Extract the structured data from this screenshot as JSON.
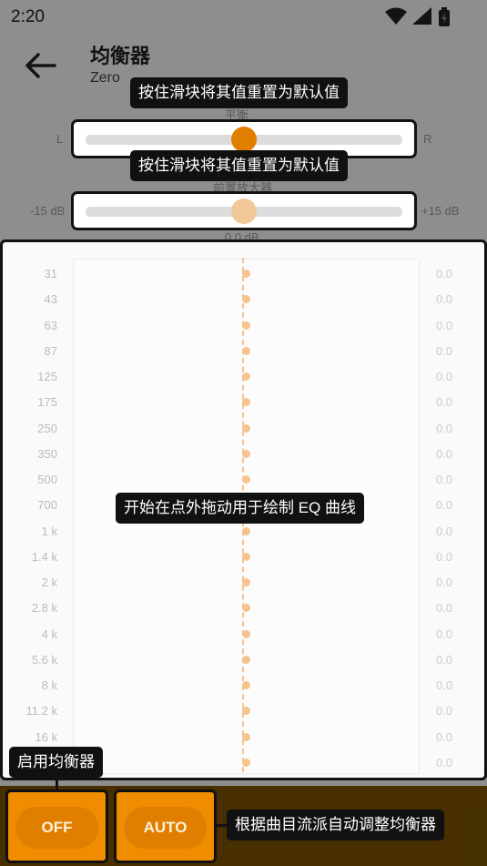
{
  "status_bar": {
    "time": "2:20"
  },
  "header": {
    "title": "均衡器",
    "subtitle": "Zero"
  },
  "balance": {
    "label": "平衡",
    "left": "L",
    "right": "R"
  },
  "preamp": {
    "label": "前置放大器",
    "min": "-15 dB",
    "max": "+15 dB",
    "value": "0.0 dB"
  },
  "tooltips": {
    "reset_slider_1": "按住滑块将其值重置为默认值",
    "reset_slider_2": "按住滑块将其值重置为默认值",
    "draw_curve": "开始在点外拖动用于绘制 EQ 曲线",
    "enable_eq": "启用均衡器",
    "auto_eq": "根据曲目流派自动调整均衡器"
  },
  "eq_bands": [
    {
      "freq": "31",
      "gain": "0.0"
    },
    {
      "freq": "43",
      "gain": "0.0"
    },
    {
      "freq": "63",
      "gain": "0.0"
    },
    {
      "freq": "87",
      "gain": "0.0"
    },
    {
      "freq": "125",
      "gain": "0.0"
    },
    {
      "freq": "175",
      "gain": "0.0"
    },
    {
      "freq": "250",
      "gain": "0.0"
    },
    {
      "freq": "350",
      "gain": "0.0"
    },
    {
      "freq": "500",
      "gain": "0.0"
    },
    {
      "freq": "700",
      "gain": "0.0"
    },
    {
      "freq": "1 k",
      "gain": "0.0"
    },
    {
      "freq": "1.4 k",
      "gain": "0.0"
    },
    {
      "freq": "2 k",
      "gain": "0.0"
    },
    {
      "freq": "2.8 k",
      "gain": "0.0"
    },
    {
      "freq": "4 k",
      "gain": "0.0"
    },
    {
      "freq": "5.6 k",
      "gain": "0.0"
    },
    {
      "freq": "8 k",
      "gain": "0.0"
    },
    {
      "freq": "11.2 k",
      "gain": "0.0"
    },
    {
      "freq": "16 k",
      "gain": "0.0"
    },
    {
      "freq": "",
      "gain": "0.0"
    }
  ],
  "buttons": {
    "off": "OFF",
    "auto": "AUTO"
  },
  "colors": {
    "accent": "#f08c00",
    "thumb_active": "#e07e00",
    "thumb_muted": "#f0c89a",
    "eq_dot": "#f6c38e"
  }
}
